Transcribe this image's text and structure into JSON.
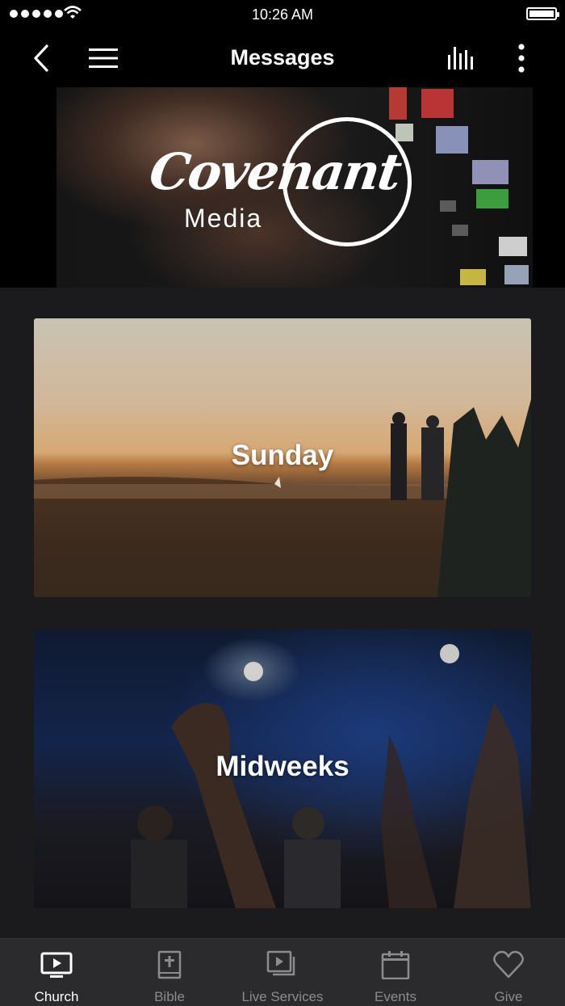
{
  "status_bar": {
    "time": "10:26 AM"
  },
  "header": {
    "title": "Messages"
  },
  "hero": {
    "logo_script": "Covenant",
    "logo_sub": "Media"
  },
  "cards": [
    {
      "label": "Sunday"
    },
    {
      "label": "Midweeks"
    }
  ],
  "tabs": [
    {
      "label": "Church",
      "icon": "tv-play-icon",
      "active": true
    },
    {
      "label": "Bible",
      "icon": "bible-icon",
      "active": false
    },
    {
      "label": "Live Services",
      "icon": "video-stack-icon",
      "active": false
    },
    {
      "label": "Events",
      "icon": "calendar-icon",
      "active": false
    },
    {
      "label": "Give",
      "icon": "heart-icon",
      "active": false
    }
  ],
  "colors": {
    "background": "#1b1b1d",
    "bar": "#000000",
    "tabbar": "#2b2b2d",
    "inactive": "#8c8c8e",
    "active": "#ffffff"
  }
}
